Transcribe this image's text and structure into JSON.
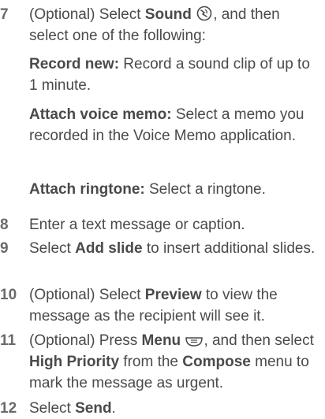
{
  "steps": [
    {
      "number": "7",
      "optional": "(Optional)",
      "text_a": " Select ",
      "bold_a": "Sound",
      "icon": "sound-app-icon",
      "text_b": ", and then select one of the following:"
    },
    {
      "number": "8",
      "text": "Enter a text message or caption."
    },
    {
      "number": "9",
      "text_a": "Select ",
      "bold_a": "Add slide",
      "text_b": " to insert additional slides."
    },
    {
      "number": "10",
      "optional": "(Optional)",
      "text_a": " Select ",
      "bold_a": "Preview",
      "text_b": " to view the message as the recipient will see it."
    },
    {
      "number": "11",
      "optional": "(Optional)",
      "text_a": " Press ",
      "bold_a": "Menu",
      "icon": "menu-key-icon",
      "text_b": ", and then select ",
      "bold_b": "High Priority",
      "text_c": " from the ",
      "bold_c": "Compose",
      "text_d": " menu to mark the message as urgent."
    },
    {
      "number": "12",
      "text_a": "Select ",
      "bold_a": "Send",
      "text_b": "."
    }
  ],
  "options": [
    {
      "label": "Record new:",
      "text": " Record a sound clip of up to 1 minute."
    },
    {
      "label": "Attach voice memo:",
      "text": " Select a memo you recorded in the Voice Memo application."
    },
    {
      "label": "Attach ringtone:",
      "text": " Select a ringtone."
    }
  ]
}
